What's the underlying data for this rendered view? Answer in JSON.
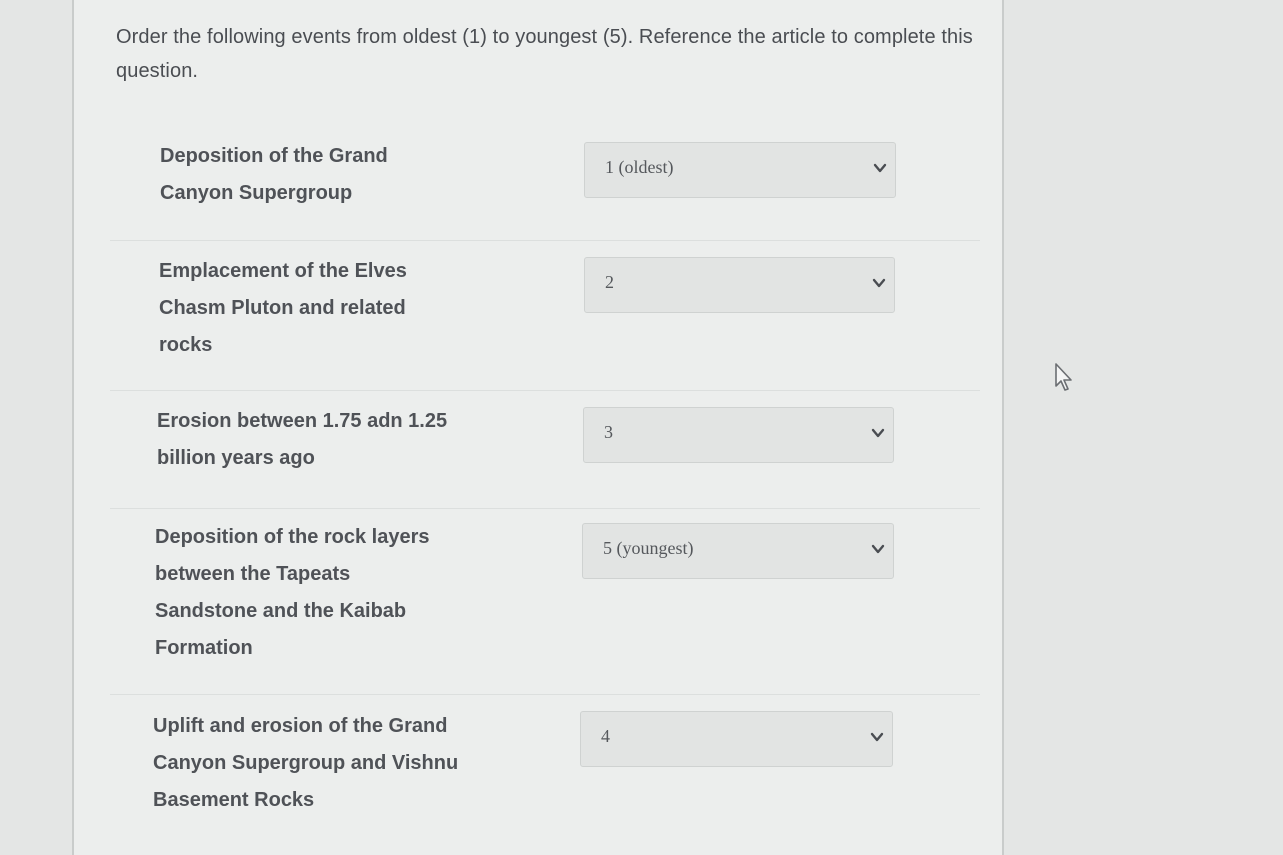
{
  "question": {
    "text": "Order the following events from oldest (1) to youngest (5). Reference the article to complete this question."
  },
  "items": [
    {
      "label_lines": [
        "Deposition of the Grand",
        "Canyon Supergroup"
      ],
      "selected": "1 (oldest)"
    },
    {
      "label_lines": [
        "Emplacement of the Elves",
        "Chasm Pluton and related",
        "rocks"
      ],
      "selected": "2"
    },
    {
      "label_lines": [
        "Erosion between 1.75 adn 1.25",
        "billion years ago"
      ],
      "selected": "3"
    },
    {
      "label_lines": [
        "Deposition of the rock layers",
        "between the Tapeats",
        "Sandstone and the Kaibab",
        "Formation"
      ],
      "selected": "5 (youngest)"
    },
    {
      "label_lines": [
        "Uplift and erosion of the Grand",
        "Canyon Supergroup and Vishnu",
        "Basement Rocks"
      ],
      "selected": "4"
    }
  ],
  "icons": {
    "dropdown": "chevron-down-icon",
    "cursor": "mouse-pointer-icon"
  }
}
